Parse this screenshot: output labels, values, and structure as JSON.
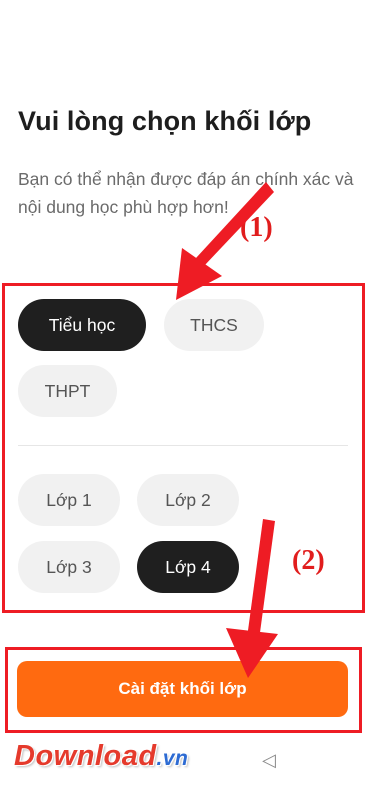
{
  "page": {
    "title": "Vui lòng chọn khối lớp",
    "description": "Bạn có thể nhận được đáp án chính xác và nội dung học phù hợp hơn!"
  },
  "levels": [
    {
      "label": "Tiểu học",
      "selected": true
    },
    {
      "label": "THCS",
      "selected": false
    },
    {
      "label": "THPT",
      "selected": false
    }
  ],
  "grades": [
    {
      "label": "Lớp 1",
      "selected": false
    },
    {
      "label": "Lớp 2",
      "selected": false
    },
    {
      "label": "Lớp 3",
      "selected": false
    },
    {
      "label": "Lớp 4",
      "selected": true
    }
  ],
  "cta": {
    "label": "Cài đặt khối lớp"
  },
  "annotations": {
    "step1": "(1)",
    "step2": "(2)"
  },
  "watermark": {
    "brand": "Download",
    "suffix": ".vn"
  },
  "nav": {
    "back_icon": "back-triangle-icon",
    "back_glyph": "◁"
  },
  "colors": {
    "accent": "#ff6a10",
    "selected_chip": "#1f1f1f",
    "chip": "#f1f1f1",
    "annotation_red": "#ee1c24"
  }
}
